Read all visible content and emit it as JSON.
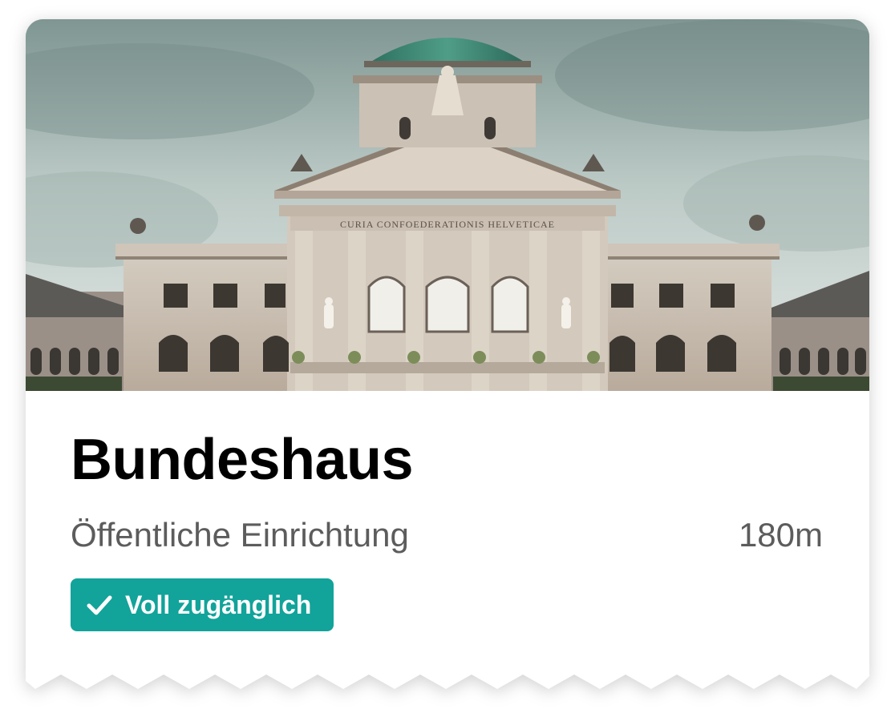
{
  "place": {
    "name": "Bundeshaus",
    "category": "Öffentliche Einrichtung",
    "distance": "180m",
    "image_alt": "Bundeshaus",
    "facade_inscription": "CURIA CONFOEDERATIONIS HELVETICAE"
  },
  "accessibility": {
    "label": "Voll zugänglich",
    "icon": "checkmark-icon",
    "color": "#12a39a"
  }
}
